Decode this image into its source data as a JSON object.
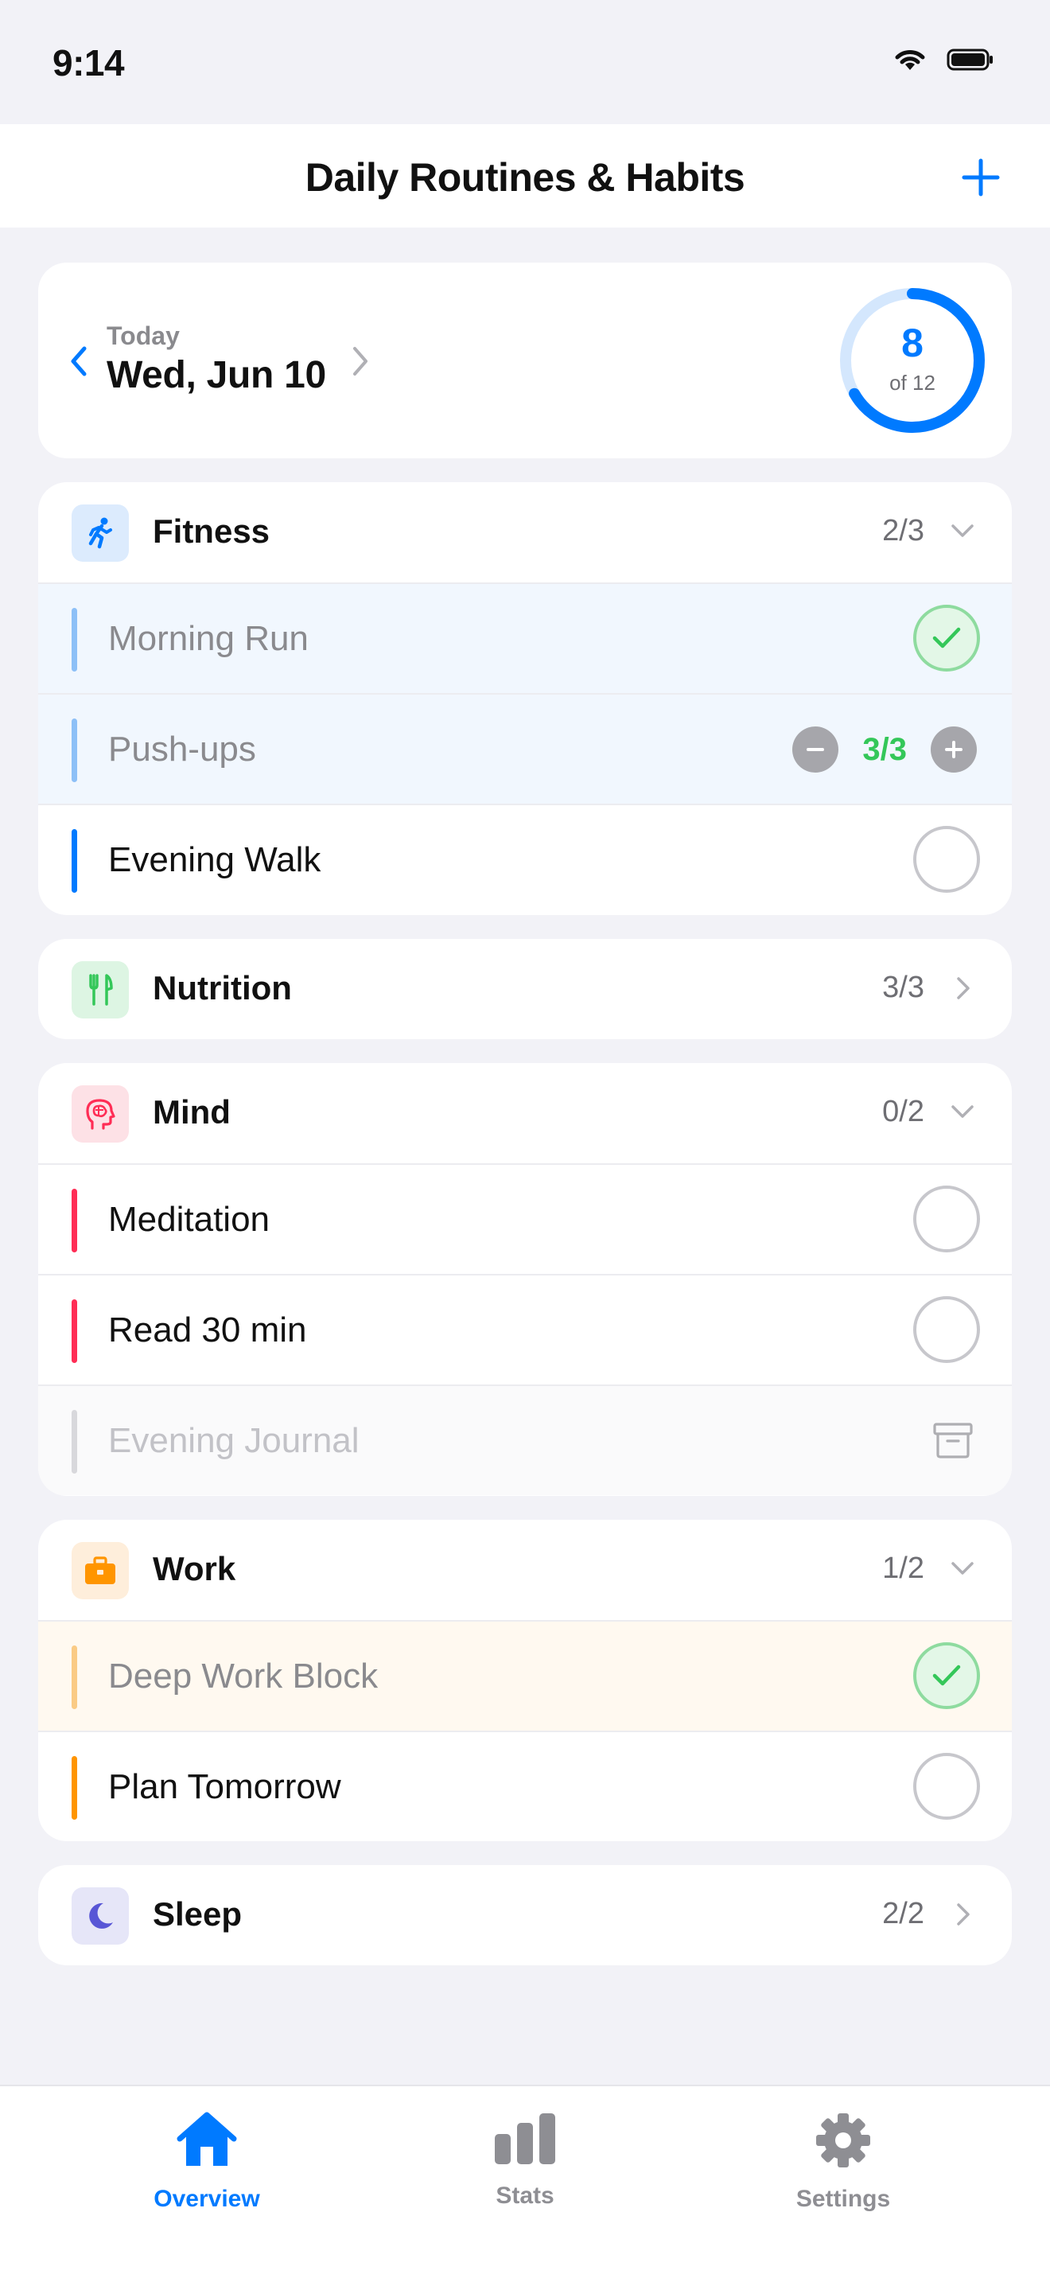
{
  "status_bar": {
    "time": "9:14"
  },
  "navbar": {
    "title": "Daily Routines & Habits"
  },
  "date_header": {
    "small_label": "Today",
    "date": "Wed, Jun 10",
    "progress_done": "8",
    "progress_total_label": "of 12",
    "progress_fraction": 0.667
  },
  "categories": [
    {
      "name": "Fitness",
      "count": "2/3",
      "expanded": true,
      "color": "#007AFF",
      "icon": "running-icon",
      "habits": [
        {
          "label": "Morning Run",
          "state": "done"
        },
        {
          "label": "Push-ups",
          "state": "done",
          "stepper_value": "3/3"
        },
        {
          "label": "Evening Walk",
          "state": "todo"
        }
      ]
    },
    {
      "name": "Nutrition",
      "count": "3/3",
      "expanded": false,
      "color": "#34C759",
      "icon": "fork-knife-icon"
    },
    {
      "name": "Mind",
      "count": "0/2",
      "expanded": true,
      "color": "#FF2D55",
      "icon": "brain-head-icon",
      "habits": [
        {
          "label": "Meditation",
          "state": "todo"
        },
        {
          "label": "Read 30 min",
          "state": "todo"
        },
        {
          "label": "Evening Journal",
          "state": "archived"
        }
      ]
    },
    {
      "name": "Work",
      "count": "1/2",
      "expanded": true,
      "color": "#FF9500",
      "icon": "briefcase-icon",
      "habits": [
        {
          "label": "Deep Work Block",
          "state": "done"
        },
        {
          "label": "Plan Tomorrow",
          "state": "todo"
        }
      ]
    },
    {
      "name": "Sleep",
      "count": "2/2",
      "expanded": false,
      "color": "#5856D6",
      "icon": "moon-icon"
    }
  ],
  "tabs": [
    {
      "label": "Overview",
      "icon": "house-icon",
      "active": true
    },
    {
      "label": "Stats",
      "icon": "bar-chart-icon",
      "active": false
    },
    {
      "label": "Settings",
      "icon": "gear-icon",
      "active": false
    }
  ]
}
